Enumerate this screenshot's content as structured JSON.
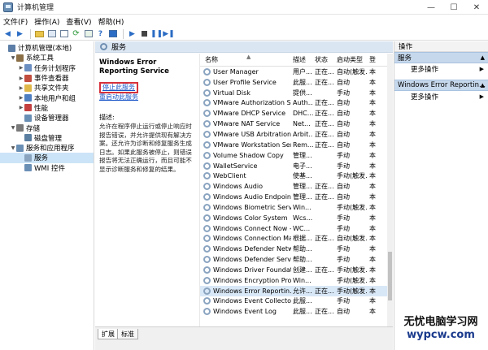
{
  "window": {
    "title": "计算机管理"
  },
  "menu": [
    "文件(F)",
    "操作(A)",
    "查看(V)",
    "帮助(H)"
  ],
  "tree": [
    {
      "label": "计算机管理(本地)",
      "level": 0,
      "exp": "",
      "color": "#5d7ea6"
    },
    {
      "label": "系统工具",
      "level": 1,
      "exp": "▼",
      "color": "#8b6f47"
    },
    {
      "label": "任务计划程序",
      "level": 2,
      "exp": "▶",
      "color": "#6c8fc2"
    },
    {
      "label": "事件查看器",
      "level": 2,
      "exp": "▶",
      "color": "#c14d3f"
    },
    {
      "label": "共享文件夹",
      "level": 2,
      "exp": "▶",
      "color": "#e0b84a"
    },
    {
      "label": "本地用户和组",
      "level": 2,
      "exp": "▶",
      "color": "#4f7fc0"
    },
    {
      "label": "性能",
      "level": 2,
      "exp": "▶",
      "color": "#c44040"
    },
    {
      "label": "设备管理器",
      "level": 2,
      "exp": "",
      "color": "#6a8fb5"
    },
    {
      "label": "存储",
      "level": 1,
      "exp": "▼",
      "color": "#7a7a7a"
    },
    {
      "label": "磁盘管理",
      "level": 2,
      "exp": "",
      "color": "#5a7ea0"
    },
    {
      "label": "服务和应用程序",
      "level": 1,
      "exp": "▼",
      "color": "#6a8fb5"
    },
    {
      "label": "服务",
      "level": 2,
      "exp": "",
      "color": "#8aa4c0",
      "selected": true
    },
    {
      "label": "WMI 控件",
      "level": 2,
      "exp": "",
      "color": "#6a8fb5"
    }
  ],
  "center": {
    "header": "服务",
    "service_title": "Windows Error Reporting Service",
    "stop_link": "停止此服务",
    "restart_link_prefix": "重",
    "restart_link_rest": "启动此服务",
    "desc_label": "描述:",
    "desc_text": "允许在程序停止运行或停止响应时报告错误，并允许提供现有解决方案。还允许为诊断和修复服务生成日志。如果此服务被停止，则错误报告将无法正确运行，而且可能不显示诊断服务和修复的结果。"
  },
  "columns": {
    "name": "名称",
    "desc": "描述",
    "status": "状态",
    "startup": "启动类型",
    "logon": "登"
  },
  "services": [
    [
      "User Manager",
      "用户...",
      "正在...",
      "自动(触发...",
      "本"
    ],
    [
      "User Profile Service",
      "此服...",
      "正在...",
      "自动",
      "本"
    ],
    [
      "Virtual Disk",
      "提供...",
      "",
      "手动",
      "本"
    ],
    [
      "VMware Authorization Se...",
      "Auth...",
      "正在...",
      "自动",
      "本"
    ],
    [
      "VMware DHCP Service",
      "DHC...",
      "正在...",
      "自动",
      "本"
    ],
    [
      "VMware NAT Service",
      "Net...",
      "正在...",
      "自动",
      "本"
    ],
    [
      "VMware USB Arbitration ...",
      "Arbit...",
      "正在...",
      "自动",
      "本"
    ],
    [
      "VMware Workstation Ser...",
      "Rem...",
      "正在...",
      "自动",
      "本"
    ],
    [
      "Volume Shadow Copy",
      "管理...",
      "",
      "手动",
      "本"
    ],
    [
      "WalletService",
      "电子...",
      "",
      "手动",
      "本"
    ],
    [
      "WebClient",
      "使基...",
      "",
      "手动(触发...",
      "本"
    ],
    [
      "Windows Audio",
      "管理...",
      "正在...",
      "自动",
      "本"
    ],
    [
      "Windows Audio Endpoint...",
      "管理...",
      "正在...",
      "自动",
      "本"
    ],
    [
      "Windows Biometric Servi...",
      "Win...",
      "",
      "手动(触发...",
      "本"
    ],
    [
      "Windows Color System",
      "Wcs...",
      "",
      "手动",
      "本"
    ],
    [
      "Windows Connect Now - ...",
      "WC...",
      "",
      "手动",
      "本"
    ],
    [
      "Windows Connection Ma...",
      "根据...",
      "正在...",
      "自动(触发...",
      "本"
    ],
    [
      "Windows Defender Netw...",
      "帮助...",
      "",
      "手动",
      "本"
    ],
    [
      "Windows Defender Service",
      "帮助...",
      "",
      "手动",
      "本"
    ],
    [
      "Windows Driver Foundati...",
      "创建...",
      "正在...",
      "手动(触发...",
      "本"
    ],
    [
      "Windows Encryption Pro...",
      "Win...",
      "",
      "手动(触发...",
      "本"
    ],
    [
      "Windows Error Reportin...",
      "允许...",
      "正在...",
      "手动(触发...",
      "本"
    ],
    [
      "Windows Event Collector",
      "此服...",
      "",
      "手动",
      "本"
    ],
    [
      "Windows Event Log",
      "此服...",
      "正在...",
      "自动",
      "本"
    ]
  ],
  "selected_service_index": 21,
  "tabs": {
    "extended": "扩展",
    "standard": "标准"
  },
  "actions": {
    "title": "操作",
    "group1": "服务",
    "group1_more": "更多操作",
    "group2": "Windows Error Reportin...",
    "group2_more": "更多操作"
  },
  "watermark": {
    "logo": "无忧电脑学习网",
    "url": "wypcw.com"
  }
}
